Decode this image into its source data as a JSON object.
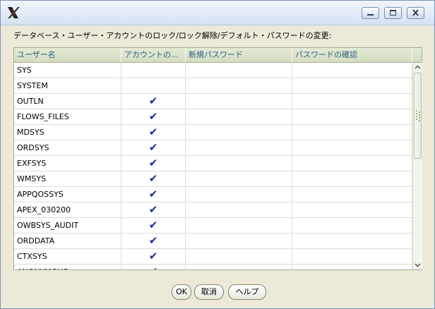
{
  "window": {
    "minimize_icon": "minimize-icon",
    "maximize_icon": "maximize-icon",
    "close_icon": "close-icon"
  },
  "instruction": "データベース・ユーザー・アカウントのロック/ロック解除/デフォルト・パスワードの変更:",
  "table": {
    "columns": [
      "ユーザー名",
      "アカウントの...",
      "新規パスワード",
      "パスワードの確認"
    ],
    "rows": [
      {
        "user": "SYS",
        "locked": false
      },
      {
        "user": "SYSTEM",
        "locked": false
      },
      {
        "user": "OUTLN",
        "locked": true
      },
      {
        "user": "FLOWS_FILES",
        "locked": true
      },
      {
        "user": "MDSYS",
        "locked": true
      },
      {
        "user": "ORDSYS",
        "locked": true
      },
      {
        "user": "EXFSYS",
        "locked": true
      },
      {
        "user": "WMSYS",
        "locked": true
      },
      {
        "user": "APPQOSSYS",
        "locked": true
      },
      {
        "user": "APEX_030200",
        "locked": true
      },
      {
        "user": "OWBSYS_AUDIT",
        "locked": true
      },
      {
        "user": "ORDDATA",
        "locked": true
      },
      {
        "user": "CTXSYS",
        "locked": true
      },
      {
        "user": "ANONYMOUS",
        "locked": true
      }
    ],
    "check_glyph": "✔"
  },
  "buttons": {
    "ok": "OK",
    "cancel": "取消",
    "help": "ヘルプ"
  },
  "colors": {
    "header_text": "#2b5e88",
    "check": "#1a2a9a"
  }
}
